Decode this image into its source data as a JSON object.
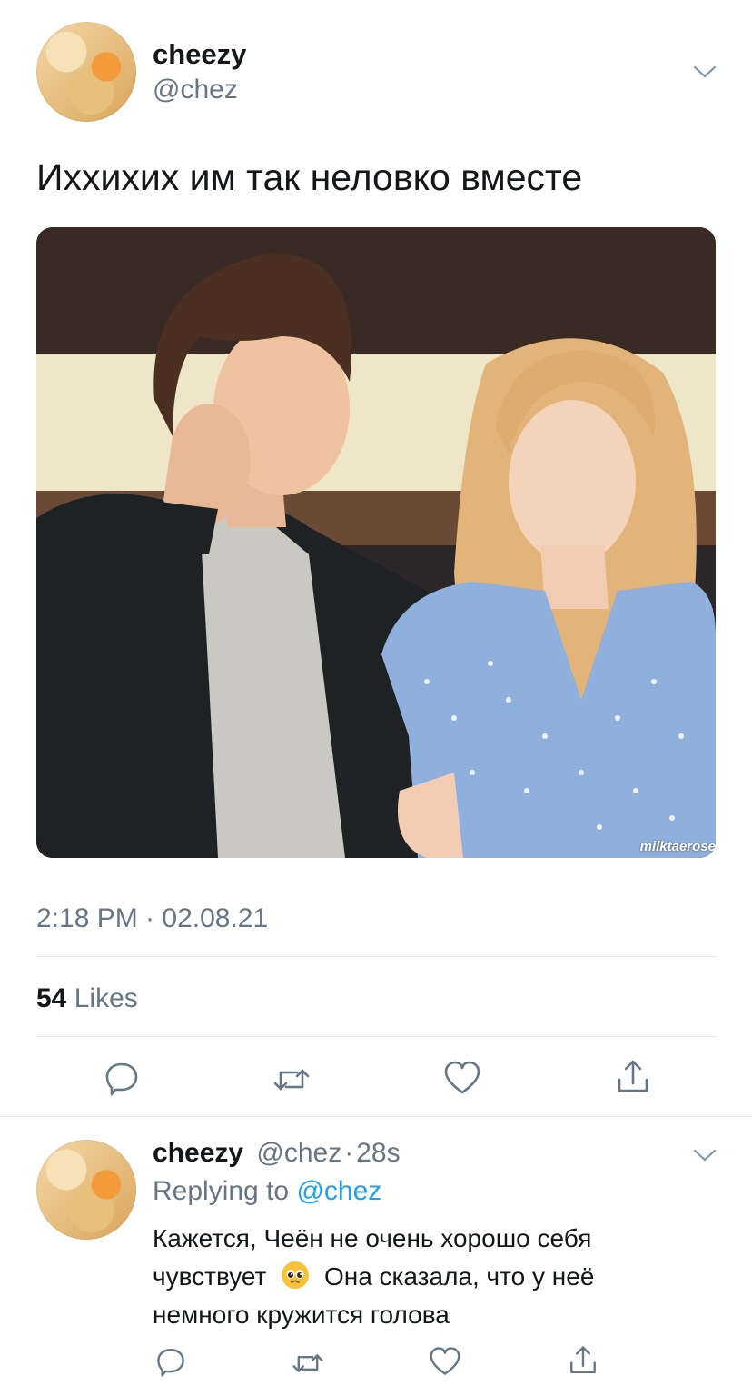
{
  "tweet": {
    "author_name": "cheezy",
    "author_handle": "@chez",
    "text": "Иххихих им так неловко вместе",
    "image_watermark": "milktaerose",
    "timestamp": "2:18 PM · 02.08.21",
    "likes_count": "54",
    "likes_label": "Likes"
  },
  "reply": {
    "author_name": "cheezy",
    "author_handle": "@chez",
    "time_sep": "·",
    "time": "28s",
    "replying_to_label": "Replying to",
    "replying_to_handle": "@chez",
    "text_line1": "Кажется, Чеён не очень хорошо себя",
    "text_line2_a": "чувствует",
    "text_line2_b": "Она сказала, что у неё",
    "text_line3": "немного кружится голова",
    "emoji": "🥺"
  },
  "icons": {
    "reply": "speech-bubble",
    "retweet": "retweet-arrows",
    "like": "heart",
    "share": "share-upload",
    "more": "chevron-down"
  },
  "colors": {
    "text": "#14171a",
    "muted": "#657786",
    "link": "#1da1f2",
    "divider": "#e1e8ed"
  }
}
